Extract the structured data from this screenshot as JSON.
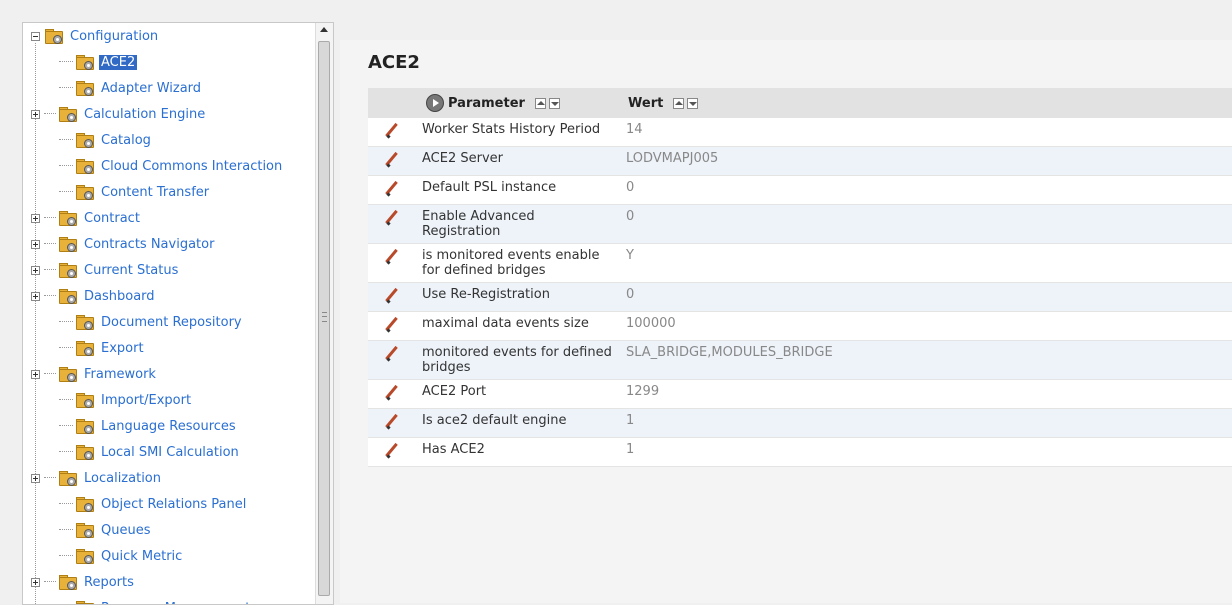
{
  "tree": {
    "root_label": "Configuration",
    "items": [
      {
        "label": "ACE2",
        "expandable": false,
        "selected": true
      },
      {
        "label": "Adapter Wizard",
        "expandable": false
      },
      {
        "label": "Calculation Engine",
        "expandable": true
      },
      {
        "label": "Catalog",
        "expandable": false
      },
      {
        "label": "Cloud Commons Interaction",
        "expandable": false
      },
      {
        "label": "Content Transfer",
        "expandable": false
      },
      {
        "label": "Contract",
        "expandable": true
      },
      {
        "label": "Contracts Navigator",
        "expandable": true
      },
      {
        "label": "Current Status",
        "expandable": true
      },
      {
        "label": "Dashboard",
        "expandable": true
      },
      {
        "label": "Document Repository",
        "expandable": false
      },
      {
        "label": "Export",
        "expandable": false
      },
      {
        "label": "Framework",
        "expandable": true
      },
      {
        "label": "Import/Export",
        "expandable": false
      },
      {
        "label": "Language Resources",
        "expandable": false
      },
      {
        "label": "Local SMI Calculation",
        "expandable": false
      },
      {
        "label": "Localization",
        "expandable": true
      },
      {
        "label": "Object Relations Panel",
        "expandable": false
      },
      {
        "label": "Queues",
        "expandable": false
      },
      {
        "label": "Quick Metric",
        "expandable": false
      },
      {
        "label": "Reports",
        "expandable": true
      },
      {
        "label": "Resource Management",
        "expandable": false
      }
    ]
  },
  "main": {
    "title": "ACE2",
    "columns": {
      "parameter": "Parameter",
      "value": "Wert"
    },
    "rows": [
      {
        "parameter": "Worker Stats History Period",
        "value": "14"
      },
      {
        "parameter": "ACE2 Server",
        "value": "LODVMAPJ005"
      },
      {
        "parameter": "Default PSL instance",
        "value": "0"
      },
      {
        "parameter": "Enable Advanced Registration",
        "value": "0"
      },
      {
        "parameter": "is monitored events enable for defined bridges",
        "value": "Y"
      },
      {
        "parameter": "Use Re-Registration",
        "value": "0"
      },
      {
        "parameter": "maximal data events size",
        "value": "100000"
      },
      {
        "parameter": "monitored events for defined bridges",
        "value": "SLA_BRIDGE,MODULES_BRIDGE"
      },
      {
        "parameter": "ACE2 Port",
        "value": "1299"
      },
      {
        "parameter": "Is ace2 default engine",
        "value": "1"
      },
      {
        "parameter": "Has ACE2",
        "value": "1"
      }
    ]
  }
}
